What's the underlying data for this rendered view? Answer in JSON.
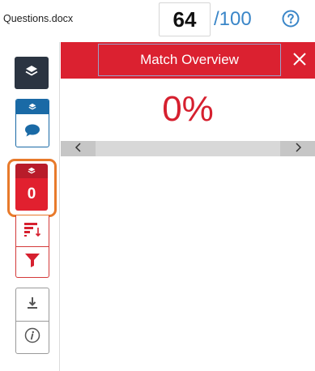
{
  "header": {
    "filename": "Questions.docx",
    "score": "64",
    "score_total": "/100",
    "help_icon": "question-circle-icon",
    "accent_color": "#3a86c8"
  },
  "sidebar": {
    "red_badge_count": "0",
    "icons": [
      "layers-icon",
      "comment-icon",
      "sort-icon",
      "filter-icon",
      "download-icon",
      "info-icon"
    ],
    "colors": {
      "dark": "#2b3441",
      "blue": "#1a6aa6",
      "red": "#e1202f",
      "highlight": "#e87a2b"
    }
  },
  "panel": {
    "title": "Match Overview",
    "percent": "0%",
    "close_icon": "close-icon",
    "scroll_left_icon": "chevron-left-icon",
    "scroll_right_icon": "chevron-right-icon",
    "header_color": "#db2130"
  }
}
